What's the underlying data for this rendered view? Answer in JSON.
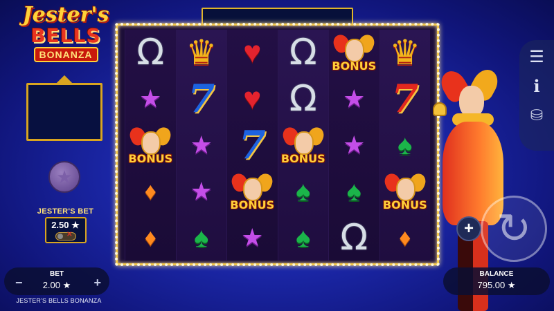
{
  "logo": {
    "line1": "Jester's",
    "line2": "BELLS",
    "line3": "BONANZA"
  },
  "jesters_bet": {
    "title": "JESTER'S BET",
    "value": "2.50 ★",
    "toggle_off_symbol": "✕"
  },
  "star_button_icon": "★",
  "reels": [
    [
      "horseshoe",
      "star",
      "bonus",
      "diamond",
      "diamond"
    ],
    [
      "crown",
      "seven-blue",
      "star",
      "star",
      "spade"
    ],
    [
      "heart",
      "heart",
      "seven-blue",
      "bonus",
      "star"
    ],
    [
      "horseshoe",
      "horseshoe",
      "bonus",
      "spade",
      "spade"
    ],
    [
      "bonus",
      "star",
      "star",
      "spade",
      "horseshoe"
    ],
    [
      "crown",
      "seven-red",
      "spade",
      "bonus",
      "diamond"
    ]
  ],
  "symbol_glyphs": {
    "horseshoe": "Ω",
    "crown": "♛",
    "heart": "♥",
    "star": "★",
    "seven-blue": "7",
    "seven-red": "7",
    "diamond": "♦",
    "spade": "♠"
  },
  "bonus_label": "BONUS",
  "menu": {
    "hamburger_icon": "☰",
    "info_icon": "i",
    "coins_icon": "⛁"
  },
  "spin_icon": "↻",
  "plus_icon": "+",
  "bet": {
    "label": "BET",
    "value": "2.00 ★",
    "minus": "−",
    "plus": "+"
  },
  "game_name": "JESTER'S BELLS BONANZA",
  "balance": {
    "label": "BALANCE",
    "value": "795.00 ★"
  }
}
